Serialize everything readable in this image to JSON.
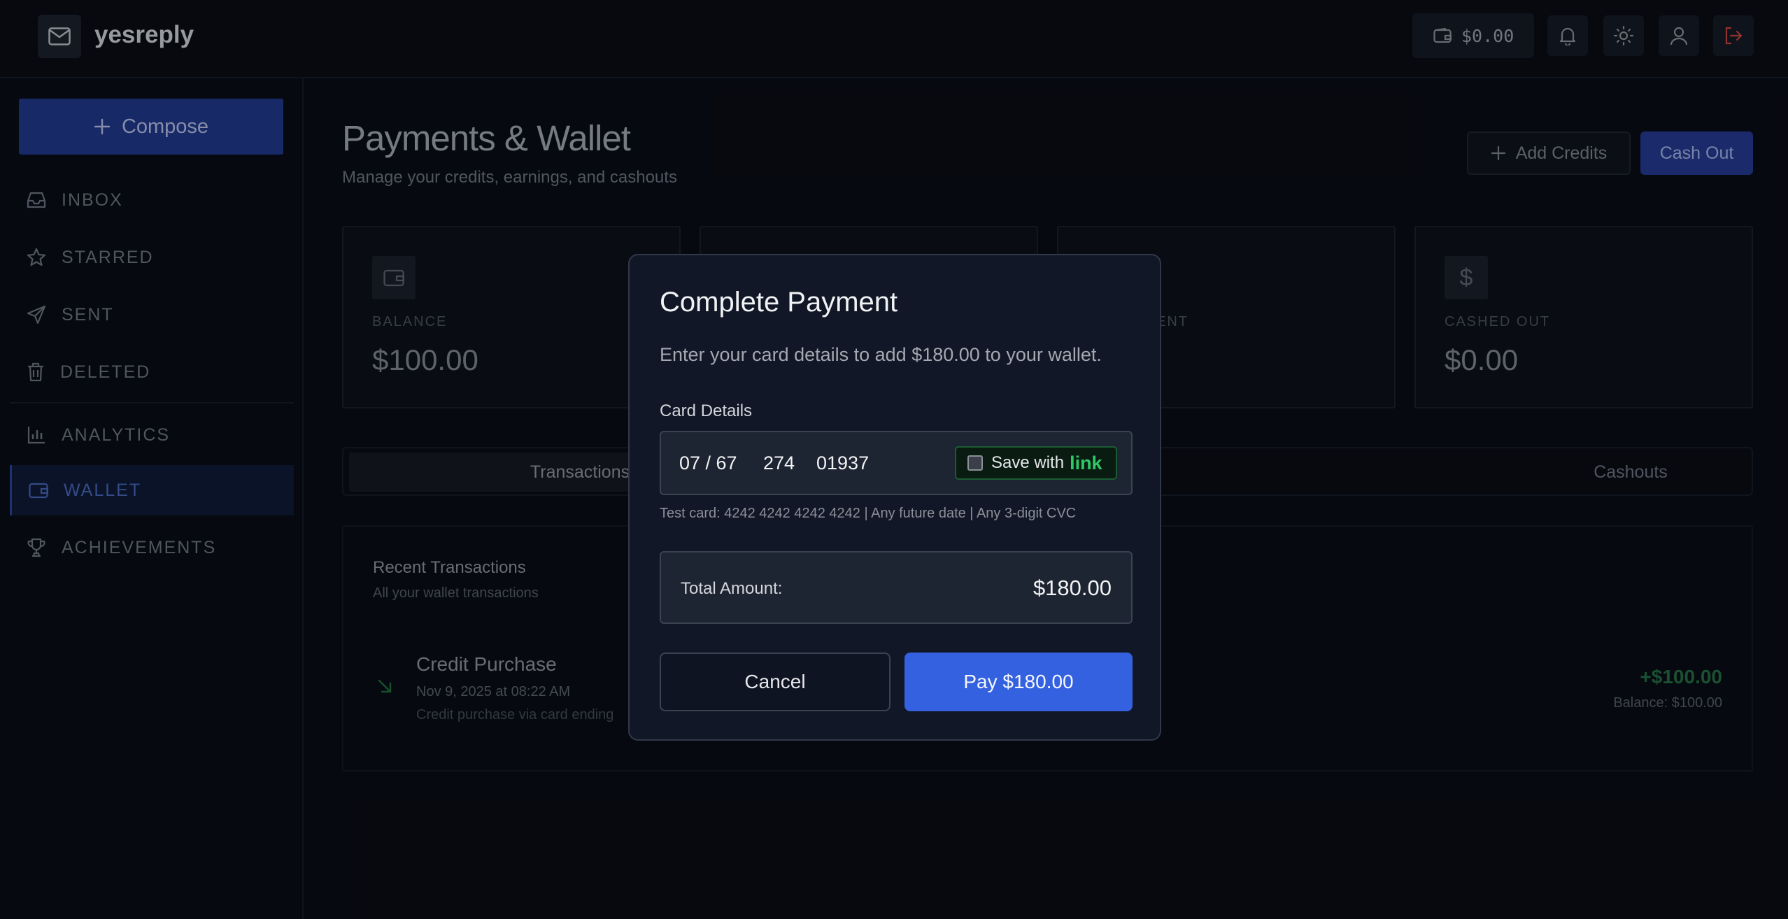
{
  "app": {
    "brand": "yesreply"
  },
  "header": {
    "wallet_balance": "$0.00"
  },
  "sidebar": {
    "compose_label": "Compose",
    "items": [
      {
        "label": "INBOX",
        "icon": "inbox-icon"
      },
      {
        "label": "STARRED",
        "icon": "star-icon"
      },
      {
        "label": "SENT",
        "icon": "send-icon"
      },
      {
        "label": "DELETED",
        "icon": "trash-icon"
      },
      {
        "label": "ANALYTICS",
        "icon": "bar-chart-icon"
      },
      {
        "label": "WALLET",
        "icon": "wallet-icon",
        "active": true
      },
      {
        "label": "ACHIEVEMENTS",
        "icon": "trophy-icon"
      }
    ]
  },
  "page": {
    "title": "Payments & Wallet",
    "subtitle": "Manage your credits, earnings, and cashouts",
    "add_credits_label": "Add Credits",
    "cash_out_label": "Cash Out"
  },
  "stats": [
    {
      "label": "BALANCE",
      "value": "$100.00",
      "icon": "wallet-icon"
    },
    {
      "label": "",
      "value": "",
      "icon": ""
    },
    {
      "label": "ENT",
      "value": "",
      "icon": ""
    },
    {
      "label": "CASHED OUT",
      "value": "$0.00",
      "icon": "dollar-icon"
    }
  ],
  "tabs": [
    {
      "label": "Transactions",
      "active": true
    },
    {
      "label": "Cashouts",
      "active": false
    }
  ],
  "transactions": {
    "title": "Recent Transactions",
    "subtitle": "All your wallet transactions",
    "items": [
      {
        "name": "Credit Purchase",
        "date": "Nov 9, 2025 at 08:22 AM",
        "desc": "Credit purchase via card ending",
        "amount": "+$100.00",
        "balance": "Balance: $100.00"
      }
    ]
  },
  "modal": {
    "title": "Complete Payment",
    "subtitle": "Enter your card details to add $180.00 to your wallet.",
    "card_label": "Card Details",
    "expiry": "07 / 67",
    "cvc": "274",
    "zip": "01937",
    "save_with": "Save with",
    "link_word": "link",
    "hint": "Test card: 4242 4242 4242 4242 | Any future date | Any 3-digit CVC",
    "total_label": "Total Amount:",
    "total_value": "$180.00",
    "cancel_label": "Cancel",
    "pay_label": "Pay $180.00"
  },
  "colors": {
    "background": "#090c14",
    "accent": "#3361e0",
    "success": "#2ec866",
    "danger": "#d9534f"
  }
}
